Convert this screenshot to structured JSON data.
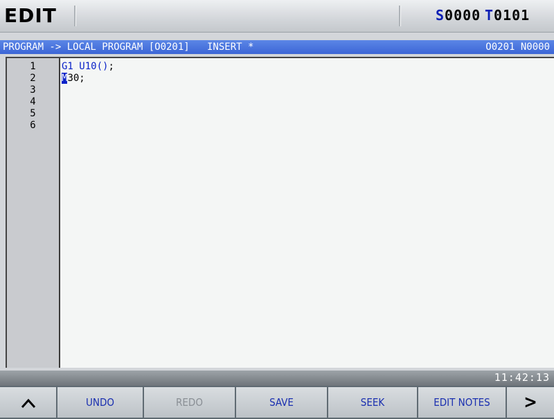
{
  "header": {
    "mode": "EDIT",
    "spindle_prefix": "S",
    "spindle_value": "0000",
    "tool_prefix": "T",
    "tool_value": "0101"
  },
  "infobar": {
    "path": "PROGRAM -> LOCAL PROGRAM [O0201]   INSERT *",
    "program_info": "O0201 N0000"
  },
  "editor": {
    "line_numbers": [
      "1",
      "2",
      "3",
      "4",
      "5",
      "6"
    ],
    "lines": [
      {
        "parts": [
          {
            "t": "G1",
            "kw": true
          },
          {
            "t": " ",
            "kw": false
          },
          {
            "t": "U10()",
            "kw": true
          },
          {
            "t": ";",
            "kw": false
          }
        ]
      },
      {
        "parts": [
          {
            "t": "M",
            "kw": true,
            "cursor": true
          },
          {
            "t": "30;",
            "kw": false
          }
        ]
      }
    ]
  },
  "status": {
    "time": "11:42:13"
  },
  "softkeys": {
    "prev": "^",
    "undo": "UNDO",
    "redo": "REDO",
    "save": "SAVE",
    "seek": "SEEK",
    "edit_notes": "EDIT NOTES",
    "next": ">"
  },
  "colors": {
    "accent_blue": "#0a22c8",
    "infobar_blue": "#4a76de"
  }
}
